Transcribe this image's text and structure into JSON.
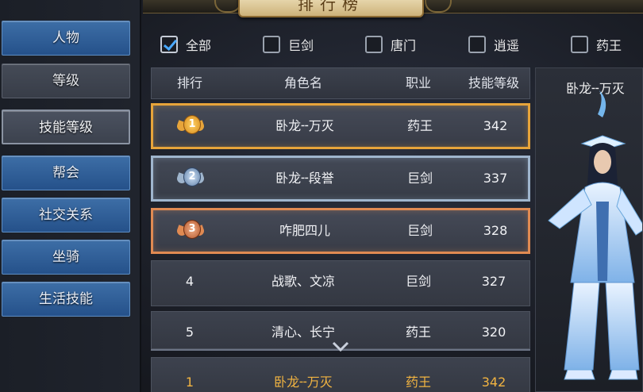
{
  "title": "排行榜",
  "sidebar": {
    "items": [
      {
        "label": "人物"
      },
      {
        "label": "等级"
      },
      {
        "label": "技能等级"
      },
      {
        "label": "帮会"
      },
      {
        "label": "社交关系"
      },
      {
        "label": "坐骑"
      },
      {
        "label": "生活技能"
      }
    ],
    "active": "技能等级"
  },
  "filters": [
    {
      "label": "全部",
      "checked": true
    },
    {
      "label": "巨剑",
      "checked": false
    },
    {
      "label": "唐门",
      "checked": false
    },
    {
      "label": "逍遥",
      "checked": false
    },
    {
      "label": "药王",
      "checked": false
    }
  ],
  "table": {
    "headers": {
      "rank": "排行",
      "name": "角色名",
      "job": "职业",
      "level": "技能等级"
    },
    "rows": [
      {
        "rank": "1",
        "name": "卧龙╌万灭",
        "job": "药王",
        "level": "342",
        "medal": "gold"
      },
      {
        "rank": "2",
        "name": "卧龙╌段誉",
        "job": "巨剑",
        "level": "337",
        "medal": "silver"
      },
      {
        "rank": "3",
        "name": "咋肥四儿",
        "job": "巨剑",
        "level": "328",
        "medal": "bronze"
      },
      {
        "rank": "4",
        "name": "战歌、文凉",
        "job": "巨剑",
        "level": "327"
      },
      {
        "rank": "5",
        "name": "清心、长宁",
        "job": "药王",
        "level": "320"
      }
    ],
    "my_row": {
      "rank": "1",
      "name": "卧龙╌万灭",
      "job": "药王",
      "level": "342"
    }
  },
  "preview": {
    "name": "卧龙╌万灭"
  },
  "colors": {
    "accent_blue": "#2f5f9a",
    "gold": "#e7a43a",
    "silver": "#9fb5cd",
    "bronze": "#e08a52",
    "highlight_text": "#f2b441"
  }
}
